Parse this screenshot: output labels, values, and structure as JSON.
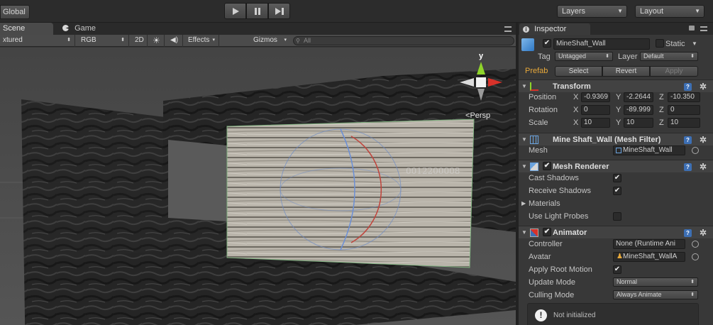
{
  "toolbar": {
    "global_label": "Global",
    "layers_label": "Layers",
    "layout_label": "Layout"
  },
  "scene": {
    "tab_scene": "Scene",
    "tab_game": "Game",
    "shading_mode": "xtured",
    "color_mode": "RGB",
    "btn_2d": "2D",
    "effects_label": "Effects",
    "gizmos_label": "Gizmos",
    "search_placeholder": "All",
    "persp_label": "Persp",
    "gizmo_y_label": "y",
    "plane_watermark": "0012200008"
  },
  "inspector": {
    "tab_label": "Inspector",
    "object_name": "MineShaft_Wall",
    "active": true,
    "static_label": "Static",
    "static": false,
    "tag_label": "Tag",
    "tag_value": "Untagged",
    "layer_label": "Layer",
    "layer_value": "Default",
    "prefab_label": "Prefab",
    "prefab_select": "Select",
    "prefab_revert": "Revert",
    "prefab_apply": "Apply",
    "transform": {
      "title": "Transform",
      "position_label": "Position",
      "position": {
        "x": "-0.9369",
        "y": "-2.2644",
        "z": "-10.350"
      },
      "rotation_label": "Rotation",
      "rotation": {
        "x": "0",
        "y": "-89.999",
        "z": "0"
      },
      "scale_label": "Scale",
      "scale": {
        "x": "10",
        "y": "10",
        "z": "10"
      },
      "axis_x": "X",
      "axis_y": "Y",
      "axis_z": "Z"
    },
    "mesh_filter": {
      "title": "Mine Shaft_Wall (Mesh Filter)",
      "mesh_label": "Mesh",
      "mesh_value": "MineShaft_Wall"
    },
    "mesh_renderer": {
      "title": "Mesh Renderer",
      "enabled": true,
      "cast_shadows_label": "Cast Shadows",
      "cast_shadows": true,
      "receive_shadows_label": "Receive Shadows",
      "receive_shadows": true,
      "materials_label": "Materials",
      "light_probes_label": "Use Light Probes",
      "light_probes": false
    },
    "animator": {
      "title": "Animator",
      "enabled": true,
      "controller_label": "Controller",
      "controller_value": "None (Runtime Ani",
      "avatar_label": "Avatar",
      "avatar_value": "MineShaft_WallA",
      "apply_root_motion_label": "Apply Root Motion",
      "apply_root_motion": true,
      "update_mode_label": "Update Mode",
      "update_mode_value": "Normal",
      "culling_mode_label": "Culling Mode",
      "culling_mode_value": "Always Animate",
      "status_text": "Not initialized"
    }
  },
  "colors": {
    "prefab_label": "#e8a93a",
    "help_icon": "#3d6fb4",
    "gizmo_y": "#8fd42a",
    "gizmo_x": "#d8322a"
  }
}
